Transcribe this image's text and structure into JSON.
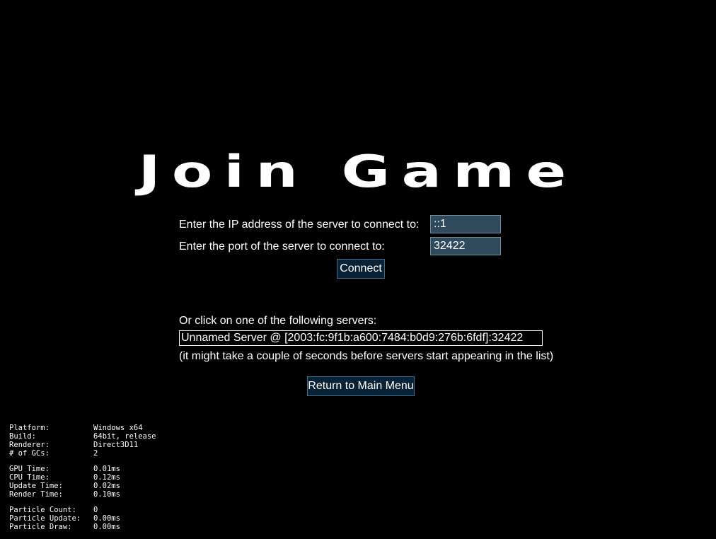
{
  "title": "Join Game",
  "form": {
    "ip_label": "Enter the IP address of the server to connect to:",
    "ip_value": "::1",
    "port_label": "Enter the port of the server to connect to:",
    "port_value": "32422",
    "connect_label": "Connect"
  },
  "servers": {
    "heading": "Or click on one of the following servers:",
    "items": [
      {
        "label": "Unnamed Server @ [2003:fc:9f1b:a600:7484:b0d9:276b:6fdf]:32422"
      }
    ],
    "hint": "(it might take a couple of seconds before servers start appearing in the list)"
  },
  "return_label": "Return to Main Menu",
  "debug": {
    "group1": [
      {
        "key": "Platform:",
        "value": "Windows x64"
      },
      {
        "key": "Build:",
        "value": "64bit, release"
      },
      {
        "key": "Renderer:",
        "value": "Direct3D11"
      },
      {
        "key": "# of GCs:",
        "value": "2"
      }
    ],
    "group2": [
      {
        "key": "GPU Time:",
        "value": "0.01ms"
      },
      {
        "key": "CPU Time:",
        "value": "0.12ms"
      },
      {
        "key": "Update Time:",
        "value": "0.02ms"
      },
      {
        "key": "Render Time:",
        "value": "0.10ms"
      }
    ],
    "group3": [
      {
        "key": "Particle Count:",
        "value": "0"
      },
      {
        "key": "Particle Update:",
        "value": "0.00ms"
      },
      {
        "key": "Particle Draw:",
        "value": "0.00ms"
      }
    ]
  },
  "colors": {
    "background": "#000000",
    "input_bg": "#2f4a5c",
    "button_bg": "#0a2236",
    "button_border": "#3f6d8c",
    "text": "#ffffff"
  }
}
